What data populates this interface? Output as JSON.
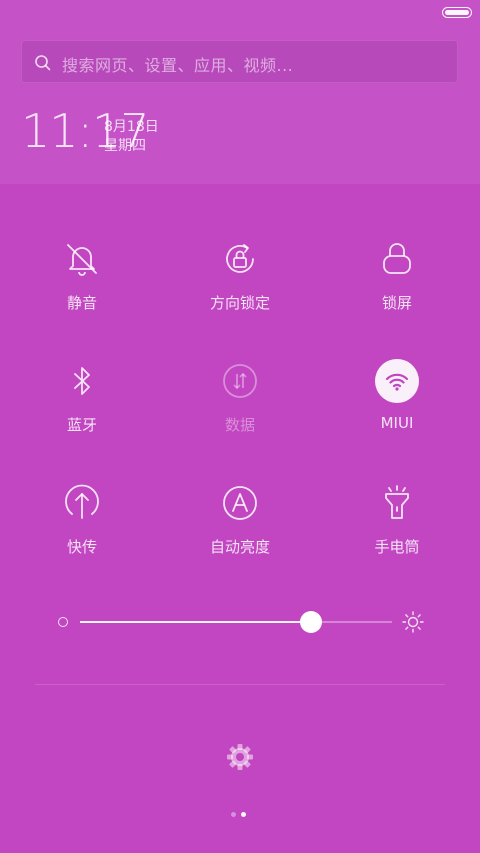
{
  "status_bar": {
    "battery_level": 1.0
  },
  "search": {
    "placeholder": "搜索网页、设置、应用、视频..."
  },
  "clock": {
    "time": "11:17",
    "date": "8月18日",
    "weekday": "星期四"
  },
  "toggles": [
    {
      "label": "静音",
      "icon": "bell-off-icon",
      "state": "off"
    },
    {
      "label": "方向锁定",
      "icon": "rotation-lock-icon",
      "state": "off"
    },
    {
      "label": "锁屏",
      "icon": "lock-icon",
      "state": "off"
    },
    {
      "label": "蓝牙",
      "icon": "bluetooth-icon",
      "state": "off"
    },
    {
      "label": "数据",
      "icon": "mobile-data-icon",
      "state": "disabled"
    },
    {
      "label": "MIUI",
      "icon": "wifi-icon",
      "state": "on"
    },
    {
      "label": "快传",
      "icon": "quick-transfer-icon",
      "state": "off"
    },
    {
      "label": "自动亮度",
      "icon": "auto-brightness-icon",
      "state": "off"
    },
    {
      "label": "手电筒",
      "icon": "flashlight-icon",
      "state": "off"
    }
  ],
  "brightness": {
    "level": 0.74
  },
  "settings": {
    "icon": "gear-icon"
  },
  "pager": {
    "pages": 2,
    "current": 1
  },
  "colors": {
    "background": "#c245c1",
    "header": "#c553c7",
    "active_icon": "#c245c1"
  }
}
